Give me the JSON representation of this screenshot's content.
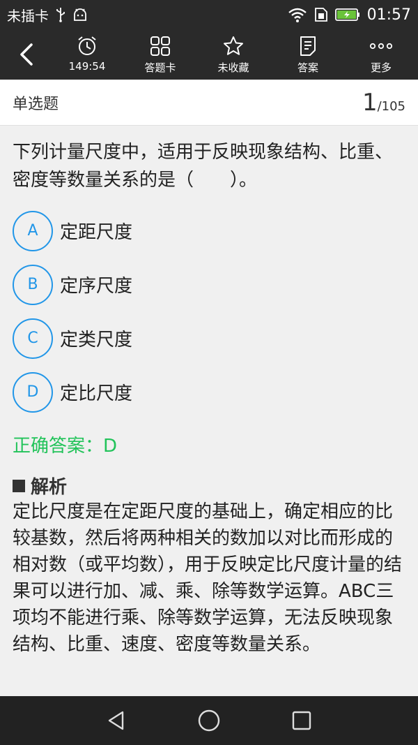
{
  "status": {
    "carrier": "未插卡",
    "time": "01:57",
    "icons": [
      "usb-icon",
      "android-debug-icon",
      "wifi-icon",
      "sim-icon",
      "battery-charging-icon"
    ]
  },
  "toolbar": {
    "timer": "149:54",
    "card": "答题卡",
    "favorite": "未收藏",
    "answer": "答案",
    "more": "更多"
  },
  "header": {
    "type": "单选题",
    "current": "1",
    "total": "/105"
  },
  "question": {
    "text": "下列计量尺度中，适用于反映现象结构、比重、密度等数量关系的是（　　）。",
    "options": [
      {
        "letter": "A",
        "text": "定距尺度"
      },
      {
        "letter": "B",
        "text": "定序尺度"
      },
      {
        "letter": "C",
        "text": "定类尺度"
      },
      {
        "letter": "D",
        "text": "定比尺度"
      }
    ],
    "correct": "正确答案：D"
  },
  "analysis": {
    "title": "解析",
    "text": "定比尺度是在定距尺度的基础上，确定相应的比较基数，然后将两种相关的数加以对比而形成的相对数（或平均数），用于反映定比尺度计量的结果可以进行加、减、乘、除等数学运算。ABC三项均不能进行乘、除等数学运算，无法反映现象结构、比重、速度、密度等数量关系。"
  },
  "colors": {
    "accent": "#2196e8",
    "correct": "#22c35a",
    "bar": "#2a2a2a"
  }
}
